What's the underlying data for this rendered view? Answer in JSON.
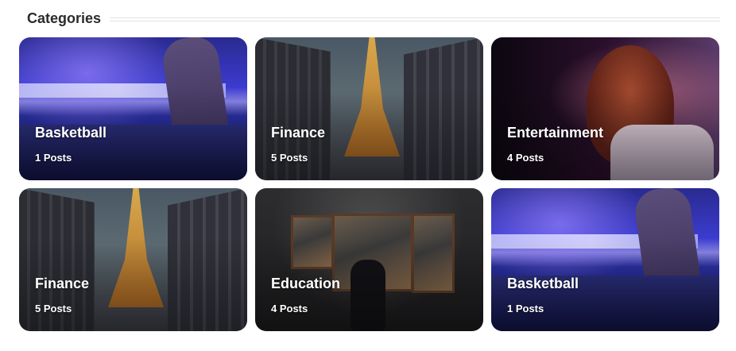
{
  "header": {
    "title": "Categories"
  },
  "cards": [
    {
      "name": "Basketball",
      "count": "1 Posts",
      "image": "dj-mixer-photo"
    },
    {
      "name": "Finance",
      "count": "5 Posts",
      "image": "eiffel-tower-street-photo"
    },
    {
      "name": "Entertainment",
      "count": "4 Posts",
      "image": "singer-microphone-photo"
    },
    {
      "name": "Finance",
      "count": "5 Posts",
      "image": "eiffel-tower-street-photo"
    },
    {
      "name": "Education",
      "count": "4 Posts",
      "image": "art-gallery-photo"
    },
    {
      "name": "Basketball",
      "count": "1 Posts",
      "image": "dj-mixer-photo"
    }
  ]
}
